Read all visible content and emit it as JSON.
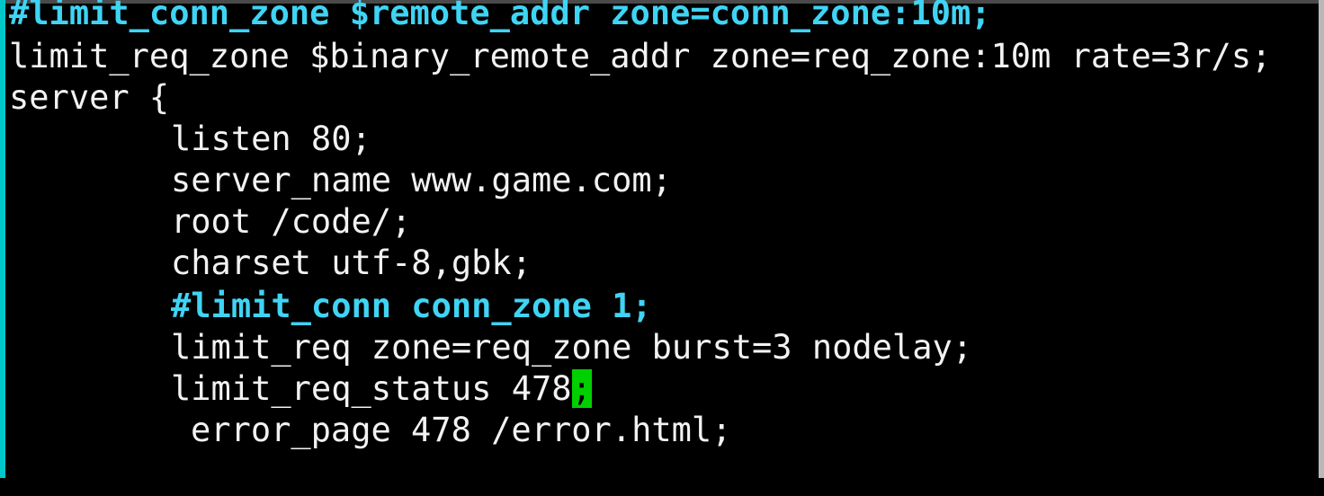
{
  "terminal": {
    "lines": [
      "#limit_conn_zone $remote_addr zone=conn_zone:10m;",
      "limit_req_zone $binary_remote_addr zone=req_zone:10m rate=3r/s;",
      "server {",
      "listen 80;",
      "server_name www.game.com;",
      "root /code/;",
      "charset utf-8,gbk;",
      "#limit_conn conn_zone 1;",
      "limit_req zone=req_zone burst=3 nodelay;",
      "limit_req_status 478",
      ";",
      "error_page 478 /error.html;"
    ],
    "colors": {
      "background": "#000000",
      "text": "#f2f2f2",
      "comment": "#3fd4f4",
      "cursor": "#00d000"
    }
  }
}
